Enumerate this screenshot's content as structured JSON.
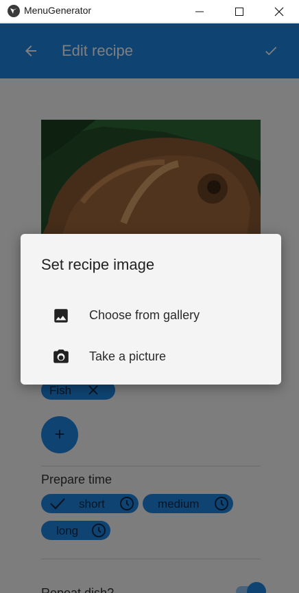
{
  "window": {
    "title": "MenuGenerator",
    "icons": [
      "app-logo-icon",
      "minimize-icon",
      "maximize-icon",
      "close-icon"
    ]
  },
  "appbar": {
    "title": "Edit recipe",
    "back_icon": "arrow-back-icon",
    "confirm_icon": "check-icon",
    "color": "#1e88e5"
  },
  "form": {
    "tags": [
      {
        "label": "Fish",
        "icon": "close-icon"
      }
    ],
    "add_icon": "add-icon",
    "prepare_time": {
      "label": "Prepare time",
      "options": [
        {
          "label": "short",
          "selected": true,
          "icon": "clock-icon"
        },
        {
          "label": "medium",
          "selected": false,
          "icon": "clock-icon"
        },
        {
          "label": "long",
          "selected": false,
          "icon": "clock-icon"
        }
      ]
    },
    "repeat": {
      "label": "Repeat dish?",
      "enabled": true
    }
  },
  "dialog": {
    "title": "Set recipe image",
    "options": [
      {
        "label": "Choose from gallery",
        "icon": "image-icon"
      },
      {
        "label": "Take a picture",
        "icon": "camera-icon"
      }
    ]
  }
}
